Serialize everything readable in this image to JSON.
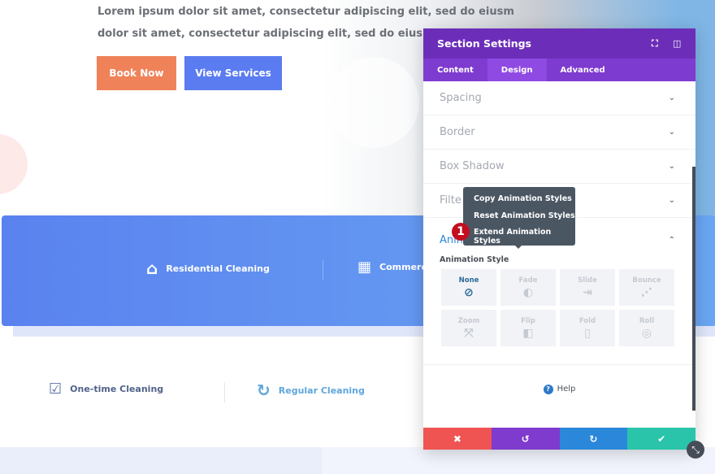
{
  "hero": {
    "line1": "Lorem ipsum dolor sit amet, consectetur adipiscing elit, sed do eiusm",
    "line2": "dolor sit amet, consectetur adipiscing elit, sed do eiusm",
    "book": "Book Now",
    "view": "View Services"
  },
  "services": [
    {
      "label": "Residential Cleaning",
      "icon": "house-icon"
    },
    {
      "label": "Commerc",
      "icon": "building-icon"
    }
  ],
  "types": [
    {
      "label": "One-time Cleaning",
      "icon": "checkbox-icon"
    },
    {
      "label": "Regular Cleaning",
      "icon": "refresh-icon"
    }
  ],
  "panel": {
    "title": "Section Settings",
    "tabs": [
      "Content",
      "Design",
      "Advanced"
    ],
    "active_tab": "Design",
    "sections": [
      "Spacing",
      "Border",
      "Box Shadow",
      "Filte"
    ],
    "animation": "Animation",
    "style_label": "Animation Style",
    "styles": [
      {
        "n": "None",
        "g": "⊘"
      },
      {
        "n": "Fade",
        "g": "◐"
      },
      {
        "n": "Slide",
        "g": "⇥"
      },
      {
        "n": "Bounce",
        "g": "⋰"
      },
      {
        "n": "Zoom",
        "g": "⤧"
      },
      {
        "n": "Flip",
        "g": "◧"
      },
      {
        "n": "Fold",
        "g": "▯"
      },
      {
        "n": "Roll",
        "g": "◎"
      }
    ],
    "selected_style": "None",
    "help": "Help",
    "footer": [
      {
        "g": "✖",
        "c": "#ef5453"
      },
      {
        "g": "↺",
        "c": "#7f3bce"
      },
      {
        "g": "↻",
        "c": "#2b87da"
      },
      {
        "g": "✔",
        "c": "#29c4a9"
      }
    ]
  },
  "menu": {
    "items": [
      "Copy Animation Styles",
      "Reset Animation Styles",
      "Extend Animation Styles"
    ],
    "badge": "1"
  },
  "colors": {
    "purple": "#6c2eb9",
    "book": "#f0825a",
    "view": "#5b7cf0"
  }
}
